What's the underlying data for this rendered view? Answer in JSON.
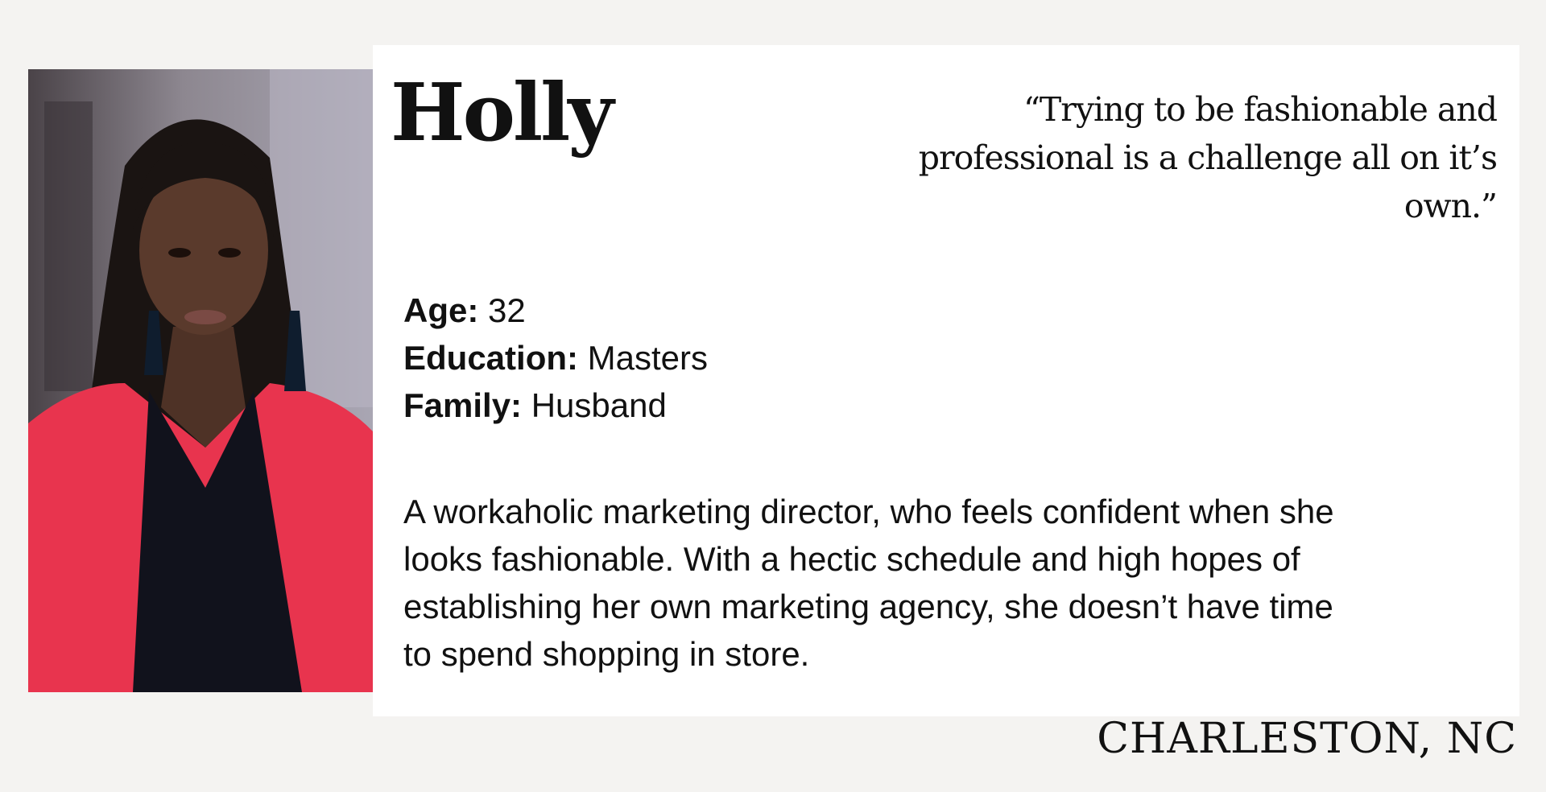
{
  "persona": {
    "name": "Holly",
    "quote": "“Trying to be fashionable and professional is a challenge all on it’s own.”",
    "facts": [
      {
        "label": "Age:",
        "value": "32"
      },
      {
        "label": "Education:",
        "value": "Masters"
      },
      {
        "label": "Family:",
        "value": "Husband"
      }
    ],
    "bio": "A workaholic marketing director, who feels confident when she looks fashionable. With a hectic schedule and high hopes of establishing her own marketing agency, she doesn’t have time to spend shopping in store.",
    "location": "CHARLESTON, NC"
  },
  "colors": {
    "page_background": "#f4f3f1",
    "card_background": "#ffffff",
    "text": "#111111",
    "jacket": "#e8344e",
    "top": "#11121c",
    "skin": "#5a3a2c",
    "hair": "#1a1412"
  }
}
